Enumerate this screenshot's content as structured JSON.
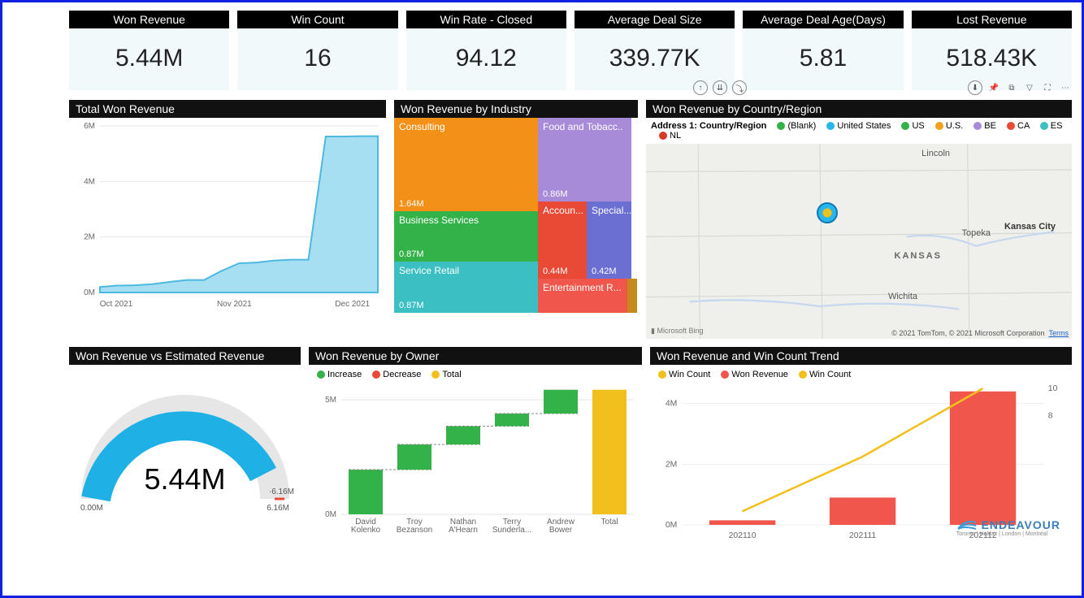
{
  "kpis": [
    {
      "label": "Won Revenue",
      "value": "5.44M"
    },
    {
      "label": "Win Count",
      "value": "16"
    },
    {
      "label": "Win Rate - Closed",
      "value": "94.12"
    },
    {
      "label": "Average Deal Size",
      "value": "339.77K"
    },
    {
      "label": "Average Deal Age(Days)",
      "value": "5.81"
    },
    {
      "label": "Lost Revenue",
      "value": "518.43K"
    }
  ],
  "area": {
    "title": "Total Won Revenue"
  },
  "treemap": {
    "title": "Won Revenue by Industry",
    "cells": {
      "consulting": {
        "label": "Consulting",
        "value": "1.64M"
      },
      "food": {
        "label": "Food and Tobacc..",
        "value": "0.86M"
      },
      "business": {
        "label": "Business Services",
        "value": "0.87M"
      },
      "service": {
        "label": "Service Retail",
        "value": "0.87M"
      },
      "accoun": {
        "label": "Accoun...",
        "value": "0.44M"
      },
      "special": {
        "label": "Special...",
        "value": "0.42M"
      },
      "entertain": {
        "label": "Entertainment R...",
        "value": ""
      }
    }
  },
  "map": {
    "title": "Won Revenue by Country/Region",
    "legend_title": "Address 1: Country/Region",
    "legend": [
      "(Blank)",
      "United States",
      "US",
      "U.S.",
      "BE",
      "CA",
      "ES",
      "NL"
    ],
    "places": {
      "lincoln": "Lincoln",
      "topeka": "Topeka",
      "kansas": "KANSAS",
      "kc": "Kansas City",
      "wichita": "Wichita"
    },
    "bing": "Microsoft Bing",
    "attrib": "© 2021 TomTom, © 2021 Microsoft Corporation",
    "terms": "Terms"
  },
  "gauge": {
    "title": "Won Revenue vs Estimated Revenue",
    "value": "5.44M",
    "min": "0.00M",
    "max": "6.16M",
    "target": "6.16M"
  },
  "owner": {
    "title": "Won Revenue by Owner",
    "legend": {
      "increase": "Increase",
      "decrease": "Decrease",
      "total": "Total"
    }
  },
  "trend": {
    "title": "Won Revenue and Win Count Trend",
    "legend": {
      "wc": "Win Count",
      "wr": "Won Revenue",
      "wc2": "Win Count"
    }
  },
  "brand": {
    "name": "ENDEAVOUR",
    "tag": "Toronto | Halifax | London | Montréal"
  },
  "chart_data": [
    {
      "id": "total_won_revenue_area",
      "type": "area",
      "title": "Total Won Revenue",
      "ylabel": "",
      "xlabel": "",
      "ylim": [
        0,
        6000000
      ],
      "yticks": [
        "0M",
        "2M",
        "4M",
        "6M"
      ],
      "xticks": [
        "Oct 2021",
        "Nov 2021",
        "Dec 2021"
      ],
      "x": [
        0,
        1,
        2,
        3,
        4,
        5,
        6,
        7,
        8,
        9,
        10,
        11,
        12,
        13,
        14,
        15,
        16
      ],
      "y": [
        200000,
        250000,
        260000,
        300000,
        380000,
        450000,
        450000,
        780000,
        1050000,
        1080000,
        1150000,
        1180000,
        1180000,
        5620000,
        5620000,
        5630000,
        5630000
      ]
    },
    {
      "id": "won_revenue_by_industry",
      "type": "treemap",
      "title": "Won Revenue by Industry",
      "series": [
        {
          "name": "Consulting",
          "value": 1640000
        },
        {
          "name": "Business Services",
          "value": 870000
        },
        {
          "name": "Service Retail",
          "value": 870000
        },
        {
          "name": "Food and Tobacco Processing",
          "value": 860000
        },
        {
          "name": "Accounting",
          "value": 440000
        },
        {
          "name": "Specialty",
          "value": 420000
        },
        {
          "name": "Entertainment Retail",
          "value": 300000
        }
      ]
    },
    {
      "id": "won_revenue_by_country",
      "type": "map",
      "title": "Won Revenue by Country/Region",
      "categories": [
        "(Blank)",
        "United States",
        "US",
        "U.S.",
        "BE",
        "CA",
        "ES",
        "NL"
      ]
    },
    {
      "id": "won_vs_estimated_gauge",
      "type": "gauge",
      "title": "Won Revenue vs Estimated Revenue",
      "value": 5440000,
      "min": 0,
      "max": 6160000,
      "target": 6160000
    },
    {
      "id": "won_revenue_by_owner_waterfall",
      "type": "bar",
      "title": "Won Revenue by Owner",
      "ylim": [
        0,
        5500000
      ],
      "yticks": [
        "0M",
        "5M"
      ],
      "categories": [
        "David Kolenko",
        "Troy Bezanson",
        "Nathan A'Hearn",
        "Terry Sunderla...",
        "Andrew Bower",
        "Total"
      ],
      "series": [
        {
          "name": "Increase",
          "values": [
            1950000,
            1100000,
            800000,
            550000,
            1040000,
            null
          ]
        },
        {
          "name": "Total",
          "values": [
            null,
            null,
            null,
            null,
            null,
            5440000
          ]
        }
      ],
      "cumulative_start": [
        0,
        1950000,
        3050000,
        3850000,
        4400000,
        0
      ]
    },
    {
      "id": "won_revenue_win_count_trend",
      "type": "line",
      "title": "Won Revenue and Win Count Trend",
      "x": [
        "202110",
        "202111",
        "202112"
      ],
      "ylim_left": [
        0,
        4500000
      ],
      "yticks_left": [
        "0M",
        "2M",
        "4M"
      ],
      "ylim_right": [
        0,
        10
      ],
      "yticks_right": [
        "8",
        "10"
      ],
      "series": [
        {
          "name": "Won Revenue",
          "axis": "left",
          "type": "bar",
          "values": [
            150000,
            900000,
            4400000
          ]
        },
        {
          "name": "Win Count",
          "axis": "right",
          "type": "line",
          "values": [
            1,
            5,
            10
          ]
        }
      ]
    }
  ]
}
